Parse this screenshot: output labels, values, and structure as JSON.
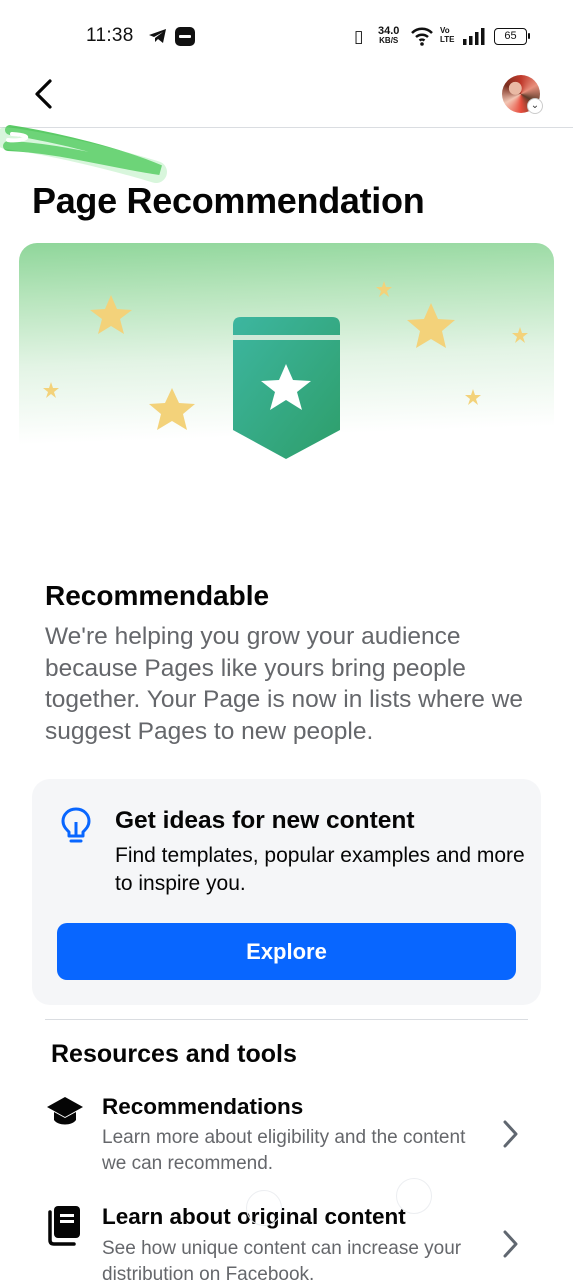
{
  "status_bar": {
    "time": "11:38",
    "speed_value": "34.0",
    "speed_unit": "KB/S",
    "volte_top": "Vo",
    "volte_bottom": "LTE",
    "battery": "65"
  },
  "header": {
    "back_icon": "arrow-left-icon",
    "avatar_alt": "profile avatar"
  },
  "page": {
    "title": "Page Recommendation"
  },
  "status_section": {
    "title": "Recommendable",
    "description": "We're helping you grow your audience because Pages like yours bring people together. Your Page is now in lists where we suggest Pages to new people."
  },
  "ideas_card": {
    "icon": "lightbulb-icon",
    "title": "Get ideas for new content",
    "description": "Find templates, popular examples and more to inspire you.",
    "button_label": "Explore"
  },
  "resources": {
    "title": "Resources and tools",
    "items": [
      {
        "icon": "graduation-cap-icon",
        "label": "Recommendations",
        "description": "Learn more about eligibility and the content we can recommend."
      },
      {
        "icon": "book-icon",
        "label": "Learn about original content",
        "description": "See how unique content can increase your distribution on Facebook."
      }
    ]
  },
  "colors": {
    "primary": "#0866ff",
    "secondary_text": "#65676b",
    "badge_green": "#2e9e6a",
    "star_yellow": "#f3d27a"
  }
}
